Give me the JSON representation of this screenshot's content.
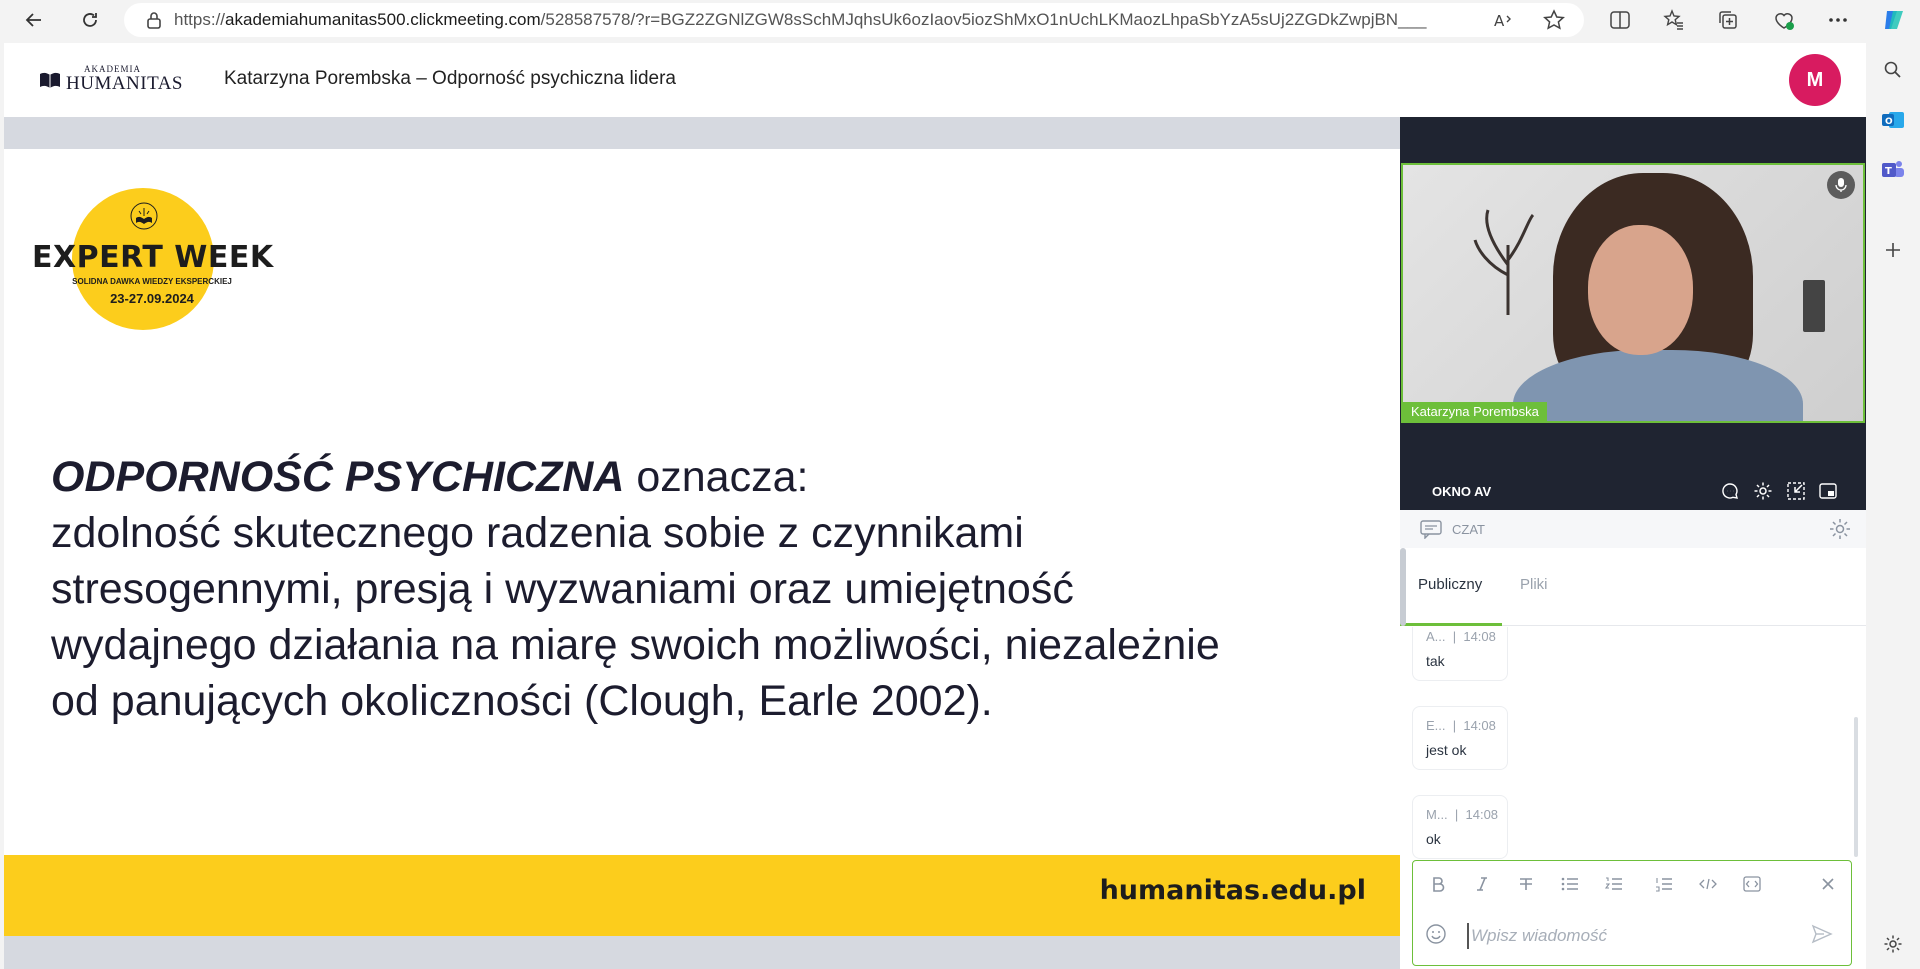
{
  "browser": {
    "url_prefix": "https://",
    "url_domain": "akademiahumanitas500.clickmeeting.com",
    "url_rest": "/528587578/?r=BGZ2ZGNlZGW8sSchMJqhsUk6ozIaov5iozShMxO1nUchLKMaozLhpaSbYzA5sUj2ZGDkZwpjBN___",
    "icons": [
      "back-icon",
      "refresh-icon",
      "lock-icon",
      "read-aloud-icon",
      "favorite-icon",
      "split-screen-icon",
      "favorites-icon",
      "collections-icon",
      "browser-essentials-icon",
      "more-icon",
      "copilot-icon"
    ]
  },
  "app": {
    "logo_small": "AKADEMIA",
    "logo_big": "HUMANITAS",
    "title": "Katarzyna Porembska – Odporność psychiczna lidera",
    "avatar_initial": "M",
    "avatar_color": "#d81b60"
  },
  "slide": {
    "badge_title": "EXPERT WEEK",
    "badge_sub": "SOLIDNA DAWKA WIEDZY EKSPERCKIEJ",
    "badge_date": "23-27.09.2024",
    "heading": "ODPORNOŚĆ PSYCHICZNA",
    "heading_rest": " oznacza:",
    "line1": "zdolność skutecznego radzenia sobie z czynnikami",
    "line2": "stresogennymi, presją i wyzwaniami oraz umiejętność",
    "line3": "wydajnego działania na miarę swoich możliwości, niezależnie",
    "line4": "od panujących okoliczności (Clough, Earle 2002).",
    "footer_url": "humanitas.edu.pl",
    "accent_color": "#fccd1c"
  },
  "video": {
    "presenter_name": "Katarzyna Porembska",
    "av_label": "OKNO AV"
  },
  "chat": {
    "title": "CZAT",
    "tabs": [
      "Publiczny",
      "Pliki"
    ],
    "messages": [
      {
        "author": "A...",
        "time": "14:08",
        "text": "tak"
      },
      {
        "author": "E...",
        "time": "14:08",
        "text": "jest ok"
      },
      {
        "author": "M...",
        "time": "14:08",
        "text": "ok"
      }
    ],
    "placeholder": "Wpisz wiadomość"
  }
}
